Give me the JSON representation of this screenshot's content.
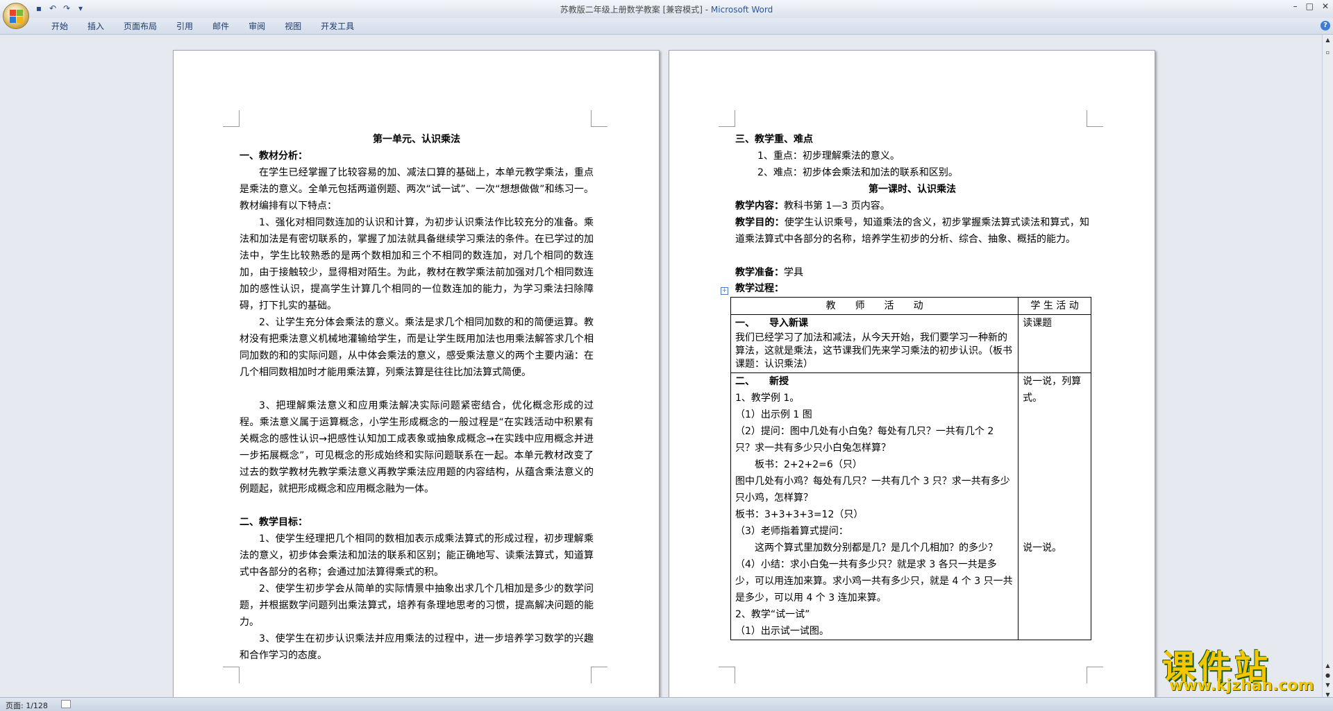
{
  "window": {
    "title_doc": "苏教版二年级上册数学教案 [兼容模式] - ",
    "title_app": "Microsoft Word"
  },
  "ribbon": {
    "tabs": [
      "开始",
      "插入",
      "页面布局",
      "引用",
      "邮件",
      "审阅",
      "视图",
      "开发工具"
    ]
  },
  "status": {
    "page": "页面: 1/128"
  },
  "page1": {
    "title": "第一单元、认识乘法",
    "h1": "一、教材分析：",
    "p1": "在学生已经掌握了比较容易的加、减法口算的基础上，本单元教学乘法，重点是乘法的意义。全单元包括两道例题、两次“试一试”、一次“想想做做”和练习一。教材编排有以下特点：",
    "p2": "1、强化对相同数连加的认识和计算，为初步认识乘法作比较充分的准备。乘法和加法是有密切联系的，掌握了加法就具备继续学习乘法的条件。在已学过的加法中，学生比较熟悉的是两个数相加和三个不相同的数连加，对几个相同的数连加，由于接触较少，显得相对陌生。为此，教材在教学乘法前加强对几个相同数连加的感性认识，提高学生计算几个相同的一位数连加的能力，为学习乘法扫除障碍，打下扎实的基础。",
    "p3": "2、让学生充分体会乘法的意义。乘法是求几个相同加数的和的简便运算。教材没有把乘法意义机械地灌输给学生，而是让学生既用加法也用乘法解答求几个相同加数的和的实际问题，从中体会乘法的意义，感受乘法意义的两个主要内涵：在几个相同数相加时才能用乘法算，列乘法算是往往比加法算式简便。",
    "p4": "3、把理解乘法意义和应用乘法解决实际问题紧密结合，优化概念形成的过程。乘法意义属于运算概念，小学生形成概念的一般过程是“在实践活动中积累有关概念的感性认识→把感性认知加工成表象或抽象成概念→在实践中应用概念并进一步拓展概念”，可见概念的形成始终和实际问题联系在一起。本单元教材改变了过去的数学教材先教学乘法意义再教学乘法应用题的内容结构，从蕴含乘法意义的例题起，就把形成概念和应用概念融为一体。",
    "h2": "二、教学目标：",
    "g1": "1、使学生经理把几个相同的数相加表示成乘法算式的形成过程，初步理解乘法的意义，初步体会乘法和加法的联系和区别；能正确地写、读乘法算式，知道算式中各部分的名称；会通过加法算得乘式的积。",
    "g2": "2、使学生初步学会从简单的实际情景中抽象出求几个几相加是多少的数学问题，并根据数学问题列出乘法算式，培养有条理地思考的习惯，提高解决问题的能力。",
    "g3": "3、使学生在初步认识乘法并应用乘法的过程中，进一步培养学习数学的兴趣和合作学习的态度。"
  },
  "page2": {
    "h3": "三、教学重、难点",
    "k1": "1、重点：初步理解乘法的意义。",
    "k2": "2、难点：初步体会乘法和加法的联系和区别。",
    "lesson_title": "第一课时、认识乘法",
    "content_label": "教学内容：",
    "content": "教科书第 1—3 页内容。",
    "goal_label": "教学目的：",
    "goal": "使学生认识乘号，知道乘法的含义，初步掌握乘法算式读法和算式，知道乘法算式中各部分的名称，培养学生初步的分析、综合、抽象、概括的能力。",
    "prep_label": "教学准备：",
    "prep": "学具",
    "process_label": "教学过程：",
    "table": {
      "col_teacher": "教　　师　　活　　动",
      "col_student": "学 生 活 动",
      "r1_head": "一、　　导入新课",
      "r1_text": "我们已经学习了加法和减法，从今天开始，我们要学习一种新的算法，这就是乘法，这节课我们先来学习乘法的初步认识。（板书课题：认识乘法）",
      "r1_student": "读课题",
      "r2_head": "二、　　新授",
      "r2_lines": [
        "1、教学例 1。",
        "（1）出示例 1 图",
        "（2）提问：图中几处有小白兔？每处有几只？一共有几个 2 只？求一共有多少只小白兔怎样算？",
        "　　板书：2+2+2=6（只）",
        "图中几处有小鸡？每处有几只？一共有几个 3 只？求一共有多少只小鸡，怎样算？",
        "板书：3+3+3+3=12（只）",
        "（3）老师指着算式提问：",
        "　　这两个算式里加数分别都是几？是几个几相加？的多少？",
        "（4）小结：求小白兔一共有多少只？就是求 3 各只一共是多少，可以用连加来算。求小鸡一共有多少只，就是 4 个 3 只一共是多少，可以用 4 个 3 连加来算。",
        "2、教学“试一试”",
        "（1）出示试一试图。"
      ],
      "r2_student1": "说一说，列算式。",
      "r2_student2": "说一说。"
    }
  },
  "watermark": {
    "cn": "课件站",
    "url": "www.kjzhan.com"
  }
}
